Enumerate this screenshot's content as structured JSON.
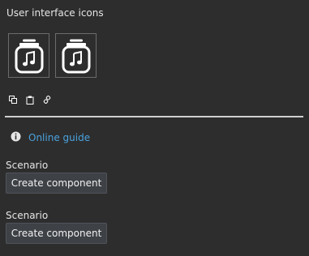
{
  "header": {
    "title": "User interface icons"
  },
  "icon_tiles": [
    {
      "icon": "music-jar-icon"
    },
    {
      "icon": "music-jar-icon"
    }
  ],
  "small_icons": [
    {
      "icon": "copy-icon"
    },
    {
      "icon": "clipboard-icon"
    },
    {
      "icon": "link-icon"
    }
  ],
  "guide": {
    "icon": "info-icon",
    "link_label": "Online guide",
    "link_color": "#4aa3df"
  },
  "scenarios": [
    {
      "label": "Scenario",
      "button_label": "Create component"
    },
    {
      "label": "Scenario",
      "button_label": "Create component"
    }
  ],
  "colors": {
    "background": "#2d2d2d",
    "text": "#e6e6e6",
    "button_bg": "#3e4146",
    "divider": "#cfcfcf"
  }
}
